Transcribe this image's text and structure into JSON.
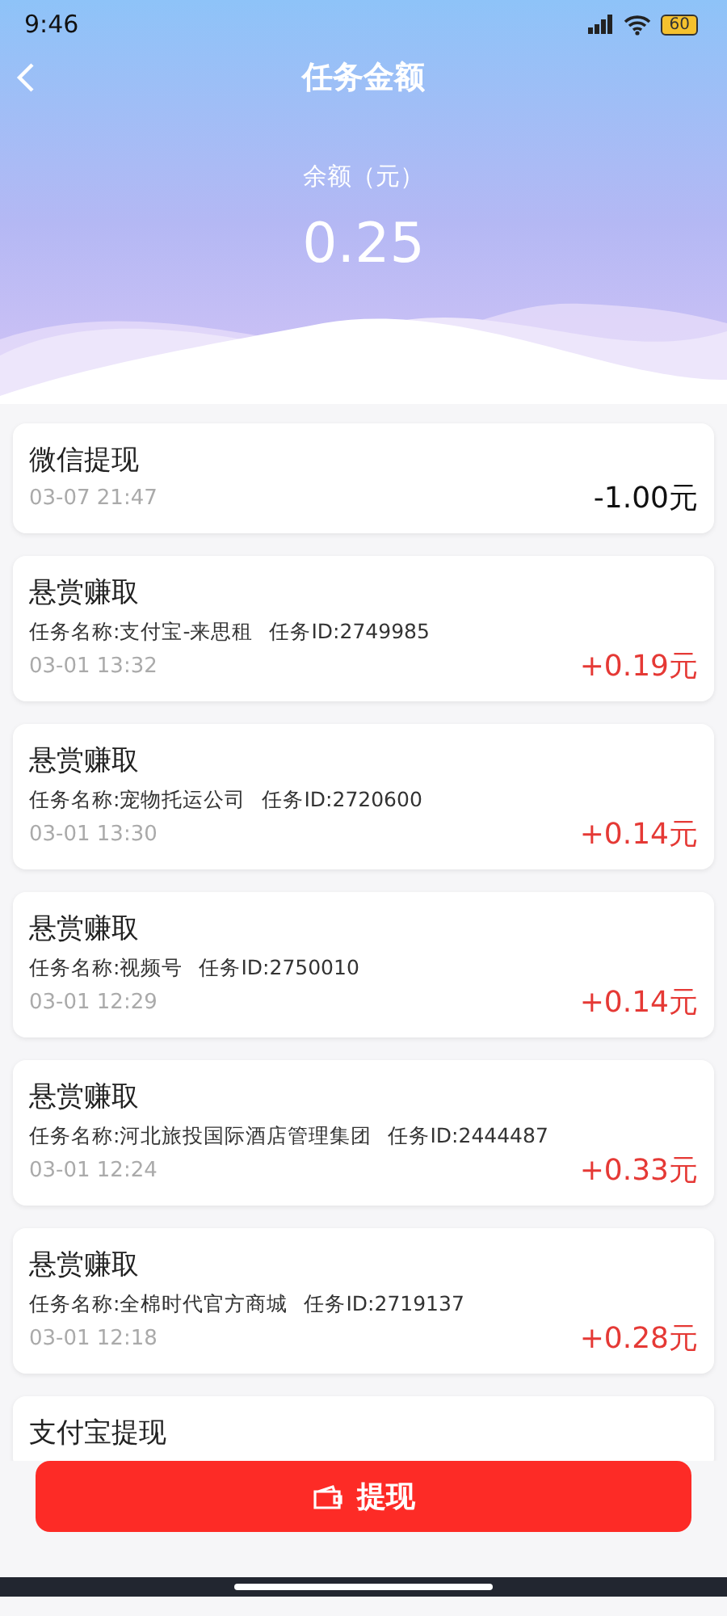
{
  "status_bar": {
    "time": "9:46",
    "battery": "60"
  },
  "header": {
    "title": "任务金额"
  },
  "balance": {
    "label": "余额（元）",
    "amount": "0.25"
  },
  "records": [
    {
      "kind": "withdrawal",
      "title": "微信提现",
      "date": "03-07 21:47",
      "amount": "-1.00元"
    },
    {
      "kind": "reward",
      "title": "悬赏赚取",
      "task_name": "任务名称:支付宝-来思租",
      "task_id": "任务ID:2749985",
      "date": "03-01 13:32",
      "amount": "+0.19元"
    },
    {
      "kind": "reward",
      "title": "悬赏赚取",
      "task_name": "任务名称:宠物托运公司",
      "task_id": "任务ID:2720600",
      "date": "03-01 13:30",
      "amount": "+0.14元"
    },
    {
      "kind": "reward",
      "title": "悬赏赚取",
      "task_name": "任务名称:视频号",
      "task_id": "任务ID:2750010",
      "date": "03-01 12:29",
      "amount": "+0.14元"
    },
    {
      "kind": "reward",
      "title": "悬赏赚取",
      "task_name": "任务名称:河北旅投国际酒店管理集团",
      "task_id": "任务ID:2444487",
      "date": "03-01 12:24",
      "amount": "+0.33元"
    },
    {
      "kind": "reward",
      "title": "悬赏赚取",
      "task_name": "任务名称:全棉时代官方商城",
      "task_id": "任务ID:2719137",
      "date": "03-01 12:18",
      "amount": "+0.28元"
    },
    {
      "kind": "withdrawal",
      "title": "支付宝提现"
    }
  ],
  "withdraw_button": {
    "label": "提现"
  }
}
